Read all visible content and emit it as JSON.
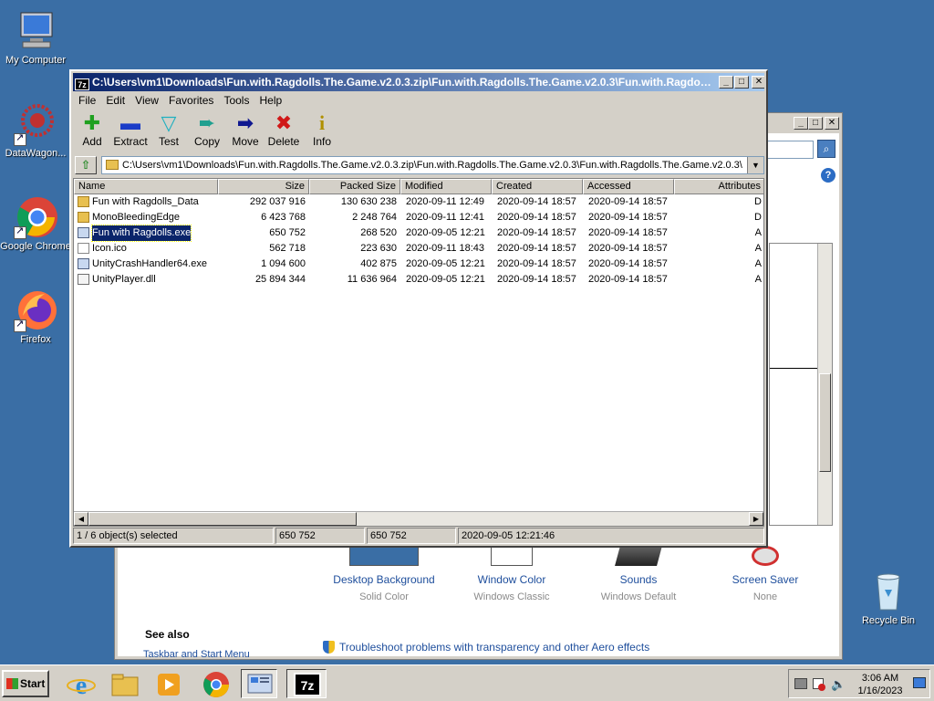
{
  "desktop": {
    "icons": [
      {
        "label": "My Computer"
      },
      {
        "label": "DataWagon..."
      },
      {
        "label": "Google Chrome"
      },
      {
        "label": "Firefox"
      },
      {
        "label": "Recycle Bin"
      }
    ]
  },
  "background_window": {
    "items": [
      {
        "title": "Desktop Background",
        "subtitle": "Solid Color"
      },
      {
        "title": "Window Color",
        "subtitle": "Windows Classic"
      },
      {
        "title": "Sounds",
        "subtitle": "Windows Default"
      },
      {
        "title": "Screen Saver",
        "subtitle": "None"
      }
    ],
    "see_also": "See also",
    "taskbar_link": "Taskbar and Start Menu",
    "troubleshoot_link": "Troubleshoot problems with transparency and other Aero effects"
  },
  "zip_window": {
    "app_icon": "7z",
    "title": "C:\\Users\\vm1\\Downloads\\Fun.with.Ragdolls.The.Game.v2.0.3.zip\\Fun.with.Ragdolls.The.Game.v2.0.3\\Fun.with.Ragdolls....",
    "menu": [
      "File",
      "Edit",
      "View",
      "Favorites",
      "Tools",
      "Help"
    ],
    "toolbar": [
      "Add",
      "Extract",
      "Test",
      "Copy",
      "Move",
      "Delete",
      "Info"
    ],
    "address": "C:\\Users\\vm1\\Downloads\\Fun.with.Ragdolls.The.Game.v2.0.3.zip\\Fun.with.Ragdolls.The.Game.v2.0.3\\Fun.with.Ragdolls.The.Game.v2.0.3\\",
    "columns": [
      "Name",
      "Size",
      "Packed Size",
      "Modified",
      "Created",
      "Accessed",
      "Attributes"
    ],
    "rows": [
      {
        "name": "Fun with Ragdolls_Data",
        "size": "292 037 916",
        "packed": "130 630 238",
        "modified": "2020-09-11 12:49",
        "created": "2020-09-14 18:57",
        "accessed": "2020-09-14 18:57",
        "attr": "D",
        "type": "folder"
      },
      {
        "name": "MonoBleedingEdge",
        "size": "6 423 768",
        "packed": "2 248 764",
        "modified": "2020-09-11 12:41",
        "created": "2020-09-14 18:57",
        "accessed": "2020-09-14 18:57",
        "attr": "D",
        "type": "folder"
      },
      {
        "name": "Fun with Ragdolls.exe",
        "size": "650 752",
        "packed": "268 520",
        "modified": "2020-09-05 12:21",
        "created": "2020-09-14 18:57",
        "accessed": "2020-09-14 18:57",
        "attr": "A",
        "type": "exe"
      },
      {
        "name": "Icon.ico",
        "size": "562 718",
        "packed": "223 630",
        "modified": "2020-09-11 18:43",
        "created": "2020-09-14 18:57",
        "accessed": "2020-09-14 18:57",
        "attr": "A",
        "type": "ico"
      },
      {
        "name": "UnityCrashHandler64.exe",
        "size": "1 094 600",
        "packed": "402 875",
        "modified": "2020-09-05 12:21",
        "created": "2020-09-14 18:57",
        "accessed": "2020-09-14 18:57",
        "attr": "A",
        "type": "exe"
      },
      {
        "name": "UnityPlayer.dll",
        "size": "25 894 344",
        "packed": "11 636 964",
        "modified": "2020-09-05 12:21",
        "created": "2020-09-14 18:57",
        "accessed": "2020-09-14 18:57",
        "attr": "A",
        "type": "dll"
      }
    ],
    "selected_row": 2,
    "status": {
      "selection": "1 / 6 object(s) selected",
      "size": "650 752",
      "packed": "650 752",
      "modified": "2020-09-05 12:21:46"
    }
  },
  "taskbar": {
    "start_label": "Start",
    "time": "3:06 AM",
    "date": "1/16/2023"
  }
}
